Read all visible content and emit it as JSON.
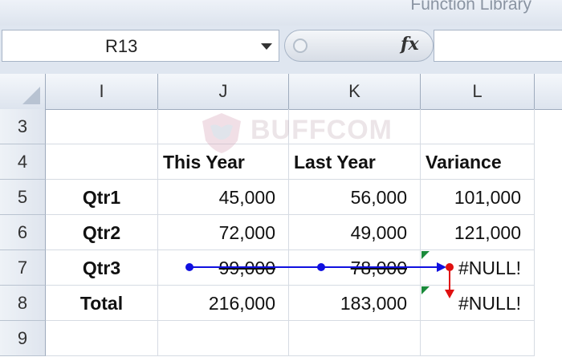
{
  "ribbon": {
    "group_label": "Function Library"
  },
  "formula_bar": {
    "name_box": "R13",
    "fx_symbol": "fx",
    "formula": ""
  },
  "columns": [
    "I",
    "J",
    "K",
    "L"
  ],
  "rows": [
    {
      "num": "3",
      "cells": [
        "",
        "",
        "",
        ""
      ]
    },
    {
      "num": "4",
      "cells": [
        "",
        "This Year",
        "Last Year",
        "Variance"
      ]
    },
    {
      "num": "5",
      "cells": [
        "Qtr1",
        "45,000",
        "56,000",
        "101,000"
      ]
    },
    {
      "num": "6",
      "cells": [
        "Qtr2",
        "72,000",
        "49,000",
        "121,000"
      ]
    },
    {
      "num": "7",
      "cells": [
        "Qtr3",
        "99,000",
        "78,000",
        "#NULL!"
      ]
    },
    {
      "num": "8",
      "cells": [
        "Total",
        "216,000",
        "183,000",
        "#NULL!"
      ]
    },
    {
      "num": "9",
      "cells": [
        "",
        "",
        "",
        ""
      ]
    }
  ],
  "watermark": {
    "text": "BUFFCOM"
  },
  "colors": {
    "trace_blue": "#1010e0",
    "trace_red": "#e01010",
    "error_flag_green": "#1a8a3a"
  }
}
